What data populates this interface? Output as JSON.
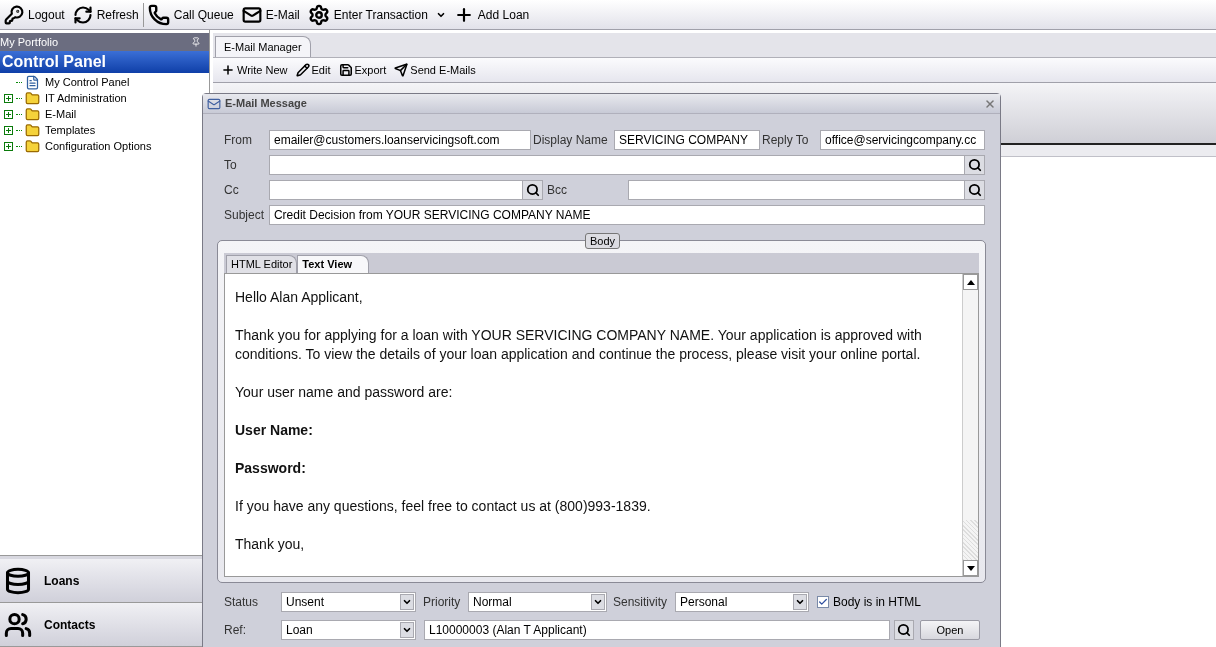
{
  "toolbar": [
    {
      "label": "Logout"
    },
    {
      "label": "Refresh"
    },
    {
      "label": "Call Queue"
    },
    {
      "label": "E-Mail"
    },
    {
      "label": "Enter Transaction"
    },
    {
      "label": "Add Loan"
    }
  ],
  "sidebar": {
    "title": "My Portfolio",
    "section": "Control Panel",
    "tree": [
      {
        "label": "My Control Panel",
        "kind": "page"
      },
      {
        "label": "IT Administration",
        "kind": "folder",
        "expanded": false
      },
      {
        "label": "E-Mail",
        "kind": "folder",
        "expanded": false
      },
      {
        "label": "Templates",
        "kind": "folder",
        "expanded": false
      },
      {
        "label": "Configuration Options",
        "kind": "folder",
        "expanded": false
      }
    ],
    "nav": [
      {
        "label": "Loans"
      },
      {
        "label": "Contacts"
      }
    ]
  },
  "document_tab": {
    "label": "E-Mail Manager",
    "selected": true
  },
  "manager_toolbar": [
    {
      "label": "Write New"
    },
    {
      "label": "Edit"
    },
    {
      "label": "Export"
    },
    {
      "label": "Send E-Mails"
    }
  ],
  "dialog": {
    "title": "E-Mail Message",
    "from": {
      "label": "From",
      "value": "emailer@customers.loanservicingsoft.com"
    },
    "display_name": {
      "label": "Display Name",
      "value": "SERVICING COMPANY"
    },
    "reply_to": {
      "label": "Reply To",
      "value": "office@servicingcompany.cc"
    },
    "to": {
      "label": "To"
    },
    "cc": {
      "label": "Cc"
    },
    "bcc": {
      "label": "Bcc"
    },
    "subject": {
      "label": "Subject",
      "value": "Credit Decision from YOUR SERVICING COMPANY NAME"
    },
    "body_group": "Body",
    "tabs": [
      {
        "label": "HTML Editor",
        "selected": false
      },
      {
        "label": "Text View",
        "selected": true
      }
    ],
    "body": [
      {
        "text": "Hello Alan Applicant,",
        "bold": false
      },
      {
        "text": "Thank you for applying for a loan with YOUR SERVICING COMPANY NAME. Your application is approved with conditions. To view the details of your loan application and continue the process, please visit your online portal.",
        "bold": false
      },
      {
        "text": "Your user name and password are:",
        "bold": false
      },
      {
        "text": "User Name:",
        "bold": true
      },
      {
        "text": "Password:",
        "bold": true
      },
      {
        "text": "If you have any questions, feel free to contact us at (800)993-1839.",
        "bold": false
      },
      {
        "text": "Thank you,",
        "bold": false
      }
    ],
    "status": {
      "label": "Status",
      "value": "Unsent"
    },
    "priority": {
      "label": "Priority",
      "value": "Normal"
    },
    "sensitivity": {
      "label": "Sensitivity",
      "value": "Personal"
    },
    "html_checkbox": {
      "label": "Body is in HTML",
      "checked": true
    },
    "ref": {
      "label": "Ref:",
      "type": "Loan",
      "value": "L10000003 (Alan T Applicant)"
    },
    "open_button": "Open"
  }
}
